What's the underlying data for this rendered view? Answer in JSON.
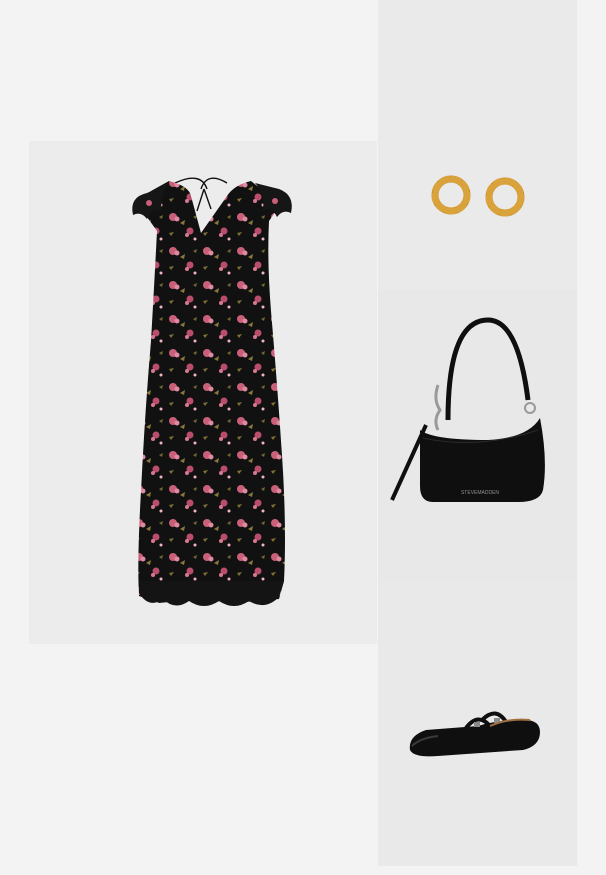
{
  "outfit": {
    "items": [
      {
        "id": "dress",
        "label": ""
      },
      {
        "id": "earrings",
        "label": ""
      },
      {
        "id": "bag",
        "label": ""
      },
      {
        "id": "shoes",
        "label": ""
      }
    ]
  },
  "bag": {
    "brand_logo": "STEVEMADDEN"
  },
  "colors": {
    "page_bg": "#f3f3f3",
    "dress_black": "#111111",
    "flower_pink": "#c9607a",
    "leaf_olive": "#8a7a3a",
    "gold": "#d9a23a",
    "leather": "#0f0f0f"
  }
}
